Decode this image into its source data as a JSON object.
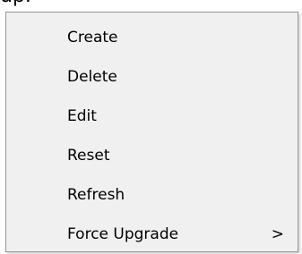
{
  "top_fragment": "up.",
  "menu": {
    "items": [
      {
        "label": "Create"
      },
      {
        "label": "Delete"
      },
      {
        "label": "Edit"
      },
      {
        "label": "Reset"
      },
      {
        "label": "Refresh"
      },
      {
        "label": "Force Upgrade",
        "submenu_indicator": ">"
      }
    ]
  }
}
